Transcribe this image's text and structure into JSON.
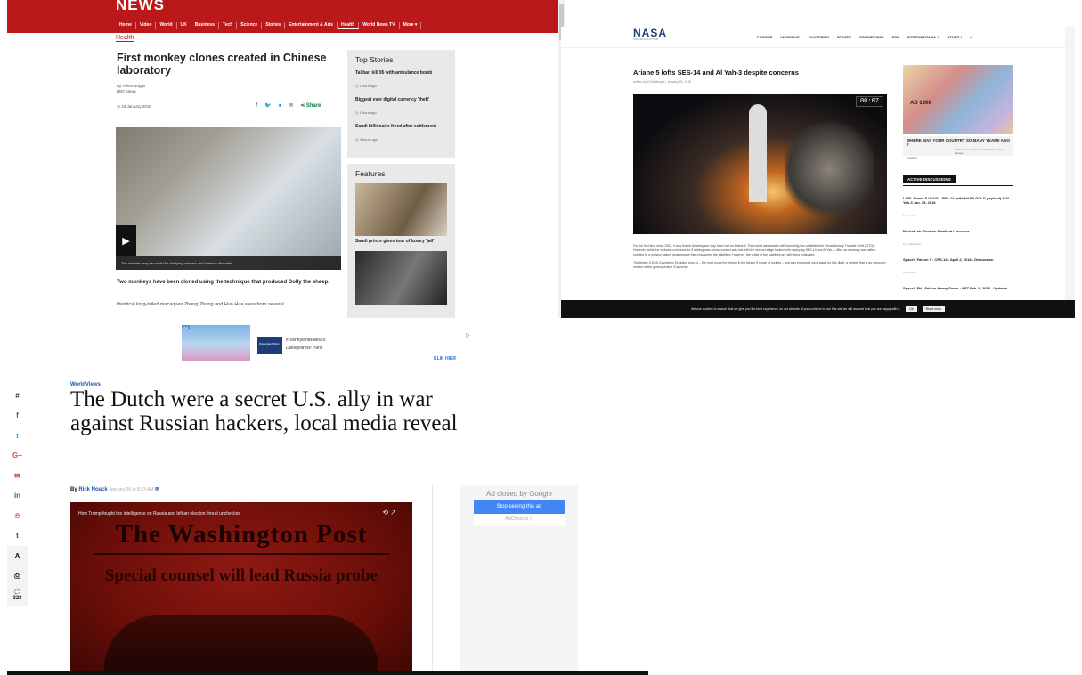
{
  "bbc": {
    "logo": "NEWS",
    "nav": [
      "Home",
      "Video",
      "World",
      "UK",
      "Business",
      "Tech",
      "Science",
      "Stories",
      "Entertainment & Arts",
      "Health",
      "World News TV",
      "More ▾"
    ],
    "section": "Health",
    "title": "First monkey clones created in Chinese laboratory",
    "byline_name": "By Helen Briggs",
    "byline_org": "BBC News",
    "date": "24 January 2018",
    "share_label": "Share",
    "caption": "The animals may be useful for studying cancers and immune disorders",
    "lead": "Two monkeys have been cloned using the technique that produced Dolly the sheep.",
    "para": "Identical long-tailed macaques Zhong Zhong and Hua Hua were born several",
    "top_stories": {
      "heading": "Top Stories",
      "items": [
        {
          "title": "Taliban kill 95 with ambulance bomb",
          "time": "1 hour ago"
        },
        {
          "title": "Biggest ever digital currency 'theft'",
          "time": "1 hour ago"
        },
        {
          "title": "Saudi billionaire freed after settlement",
          "time": "4 hours ago"
        }
      ]
    },
    "features": {
      "heading": "Features",
      "item1": "Saudi prince gives tour of luxury 'jail'"
    }
  },
  "nasa": {
    "logo": "NASA",
    "logo_sub": "SPACEFLIGHT.COM",
    "menu": [
      "FORUMS",
      "L2 SIGN-UP",
      "ELV/SRBON",
      "SPACEX",
      "COMMERCIAL",
      "ESA",
      "INTERNATIONAL ▾",
      "OTHER ▾",
      "⌕"
    ],
    "title": "Ariane 5 lofts SES-14 and Al Yah-3 despite concerns",
    "meta": "written by Chris Bergin  |  January 25, 2018",
    "video_time": "00:07",
    "body": [
      "For the first time since 2002, it was feared Arianespace may have lost an Ariane 5. The rocket was tasked with launching two satellites into Geostationary Transfer Orbit (GTO). However, while the webcast continued as if nothing was amiss, contact was lost with the second stage tasked with deploying SES-14 and Al Yah-3. After an anomaly was called, pointing to a mission failure, Arianespace then reacquired the satellites. However, the orbits of the satellites are still being evaluated.",
      "The Ariane 5 ECA (Cryogenic Evolution type A) – the most powerful version in the Ariane 5 range of rockets – and was employed once again for this flight, a vehicle that is an improved version of the generic Ariane 5 launcher."
    ],
    "ad": {
      "year": "AD 1300",
      "headline": "WHERE WAS YOUR COUNTRY SO MANY YEARS AGO ?",
      "source": "Libertiller",
      "cta": "Click here to explore the historical maps of Europe"
    },
    "discussions_heading": "ACTIVE DISCUSSIONS",
    "discussions": [
      {
        "title": "LIVE: Ariane 5 VA241 - SES-14 (with NASA GOLD payload) & Al Yah-3 Jan. 25, 2018",
        "by": "by ieranalf"
      },
      {
        "title": "RocketLab Electron Smallsat Launcher",
        "by": "by Craftyspace"
      },
      {
        "title": "SpaceX Falcon 9 : CRS-14 : April 2, 2018 - Discussion",
        "by": "by scdhrey"
      },
      {
        "title": "SpaceX FH : Falcon Heavy Demo : NET Feb. 6, 2018 - Updates",
        "by": ""
      }
    ],
    "cookie_text": "We use cookies to ensure that we give you the best experience on our website. If you continue to use this site we will assume that you are happy with it.",
    "cookie_ok": "Ok",
    "cookie_more": "Read more"
  },
  "wapo": {
    "ad": {
      "tag": "Ad",
      "thumb": "Disneyland Paris",
      "line1": "#DisneylandParis25",
      "line2": "Disneyland® Paris",
      "cta": "KLIK HIER"
    },
    "social": [
      "#",
      "f",
      "t",
      "G+",
      "✉",
      "in",
      "℗",
      "t",
      "A",
      "⎙",
      "💬"
    ],
    "comment_count": "323",
    "kicker": "WorldViews",
    "title": "The Dutch were a secret U.S. ally in war against Russian hackers, local media reveal",
    "by_prefix": "By",
    "author": "Rick Noack",
    "date": "January 26 at 8:23 AM",
    "video": {
      "title": "How Trump fought the intelligence on Russia and left an election threat unchecked",
      "masthead": "The Washington Post",
      "headline": "Special counsel will lead Russia probe"
    },
    "adbox": {
      "closed": "Ad closed by Google",
      "stop": "Stop seeing this ad",
      "choices": "AdChoices ▷"
    }
  }
}
